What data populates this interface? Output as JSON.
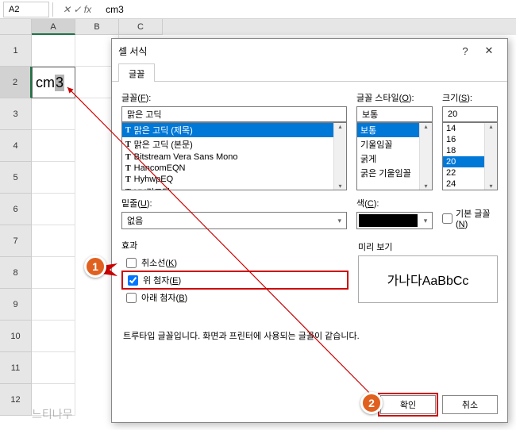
{
  "namebox": "A2",
  "formula": "cm3",
  "columns": [
    "A",
    "B",
    "C"
  ],
  "rows": [
    "1",
    "2",
    "3",
    "4",
    "5",
    "6",
    "7",
    "8",
    "9",
    "10",
    "11",
    "12"
  ],
  "cell_a2": {
    "prefix": "cm",
    "sup": "3"
  },
  "dialog": {
    "title": "셀 서식",
    "tab": "글꼴",
    "font_label_pre": "글꼴(",
    "font_label_key": "F",
    "font_label_post": "):",
    "style_label_pre": "글꼴 스타일(",
    "style_label_key": "O",
    "style_label_post": "):",
    "size_label_pre": "크기(",
    "size_label_key": "S",
    "size_label_post": "):",
    "font_value": "맑은 고딕",
    "fonts": [
      "맑은 고딕 (제목)",
      "맑은 고딕 (본문)",
      "Bitstream Vera Sans Mono",
      "HancomEQN",
      "HyhwpEQ",
      "HY견고딕"
    ],
    "style_value": "보통",
    "styles": [
      "보통",
      "기울임꼴",
      "굵게",
      "굵은 기울임꼴"
    ],
    "size_value": "20",
    "sizes": [
      "14",
      "16",
      "18",
      "20",
      "22",
      "24"
    ],
    "underline_label_pre": "밑줄(",
    "underline_label_key": "U",
    "underline_label_post": "):",
    "underline_value": "없음",
    "color_label_pre": "색(",
    "color_label_key": "C",
    "color_label_post": "):",
    "default_font_pre": "기본 글꼴(",
    "default_font_key": "N",
    "default_font_post": ")",
    "effects_label": "효과",
    "strike_pre": "취소선(",
    "strike_key": "K",
    "strike_post": ")",
    "super_pre": "위 첨자(",
    "super_key": "E",
    "super_post": ")",
    "sub_pre": "아래 첨자(",
    "sub_key": "B",
    "sub_post": ")",
    "preview_label": "미리 보기",
    "preview_text": "가나다AaBbCc",
    "note": "트루타입 글꼴입니다. 화면과 프린터에 사용되는 글꼴이 같습니다.",
    "ok": "확인",
    "cancel": "취소"
  },
  "badges": {
    "b1": "1",
    "b2": "2"
  }
}
